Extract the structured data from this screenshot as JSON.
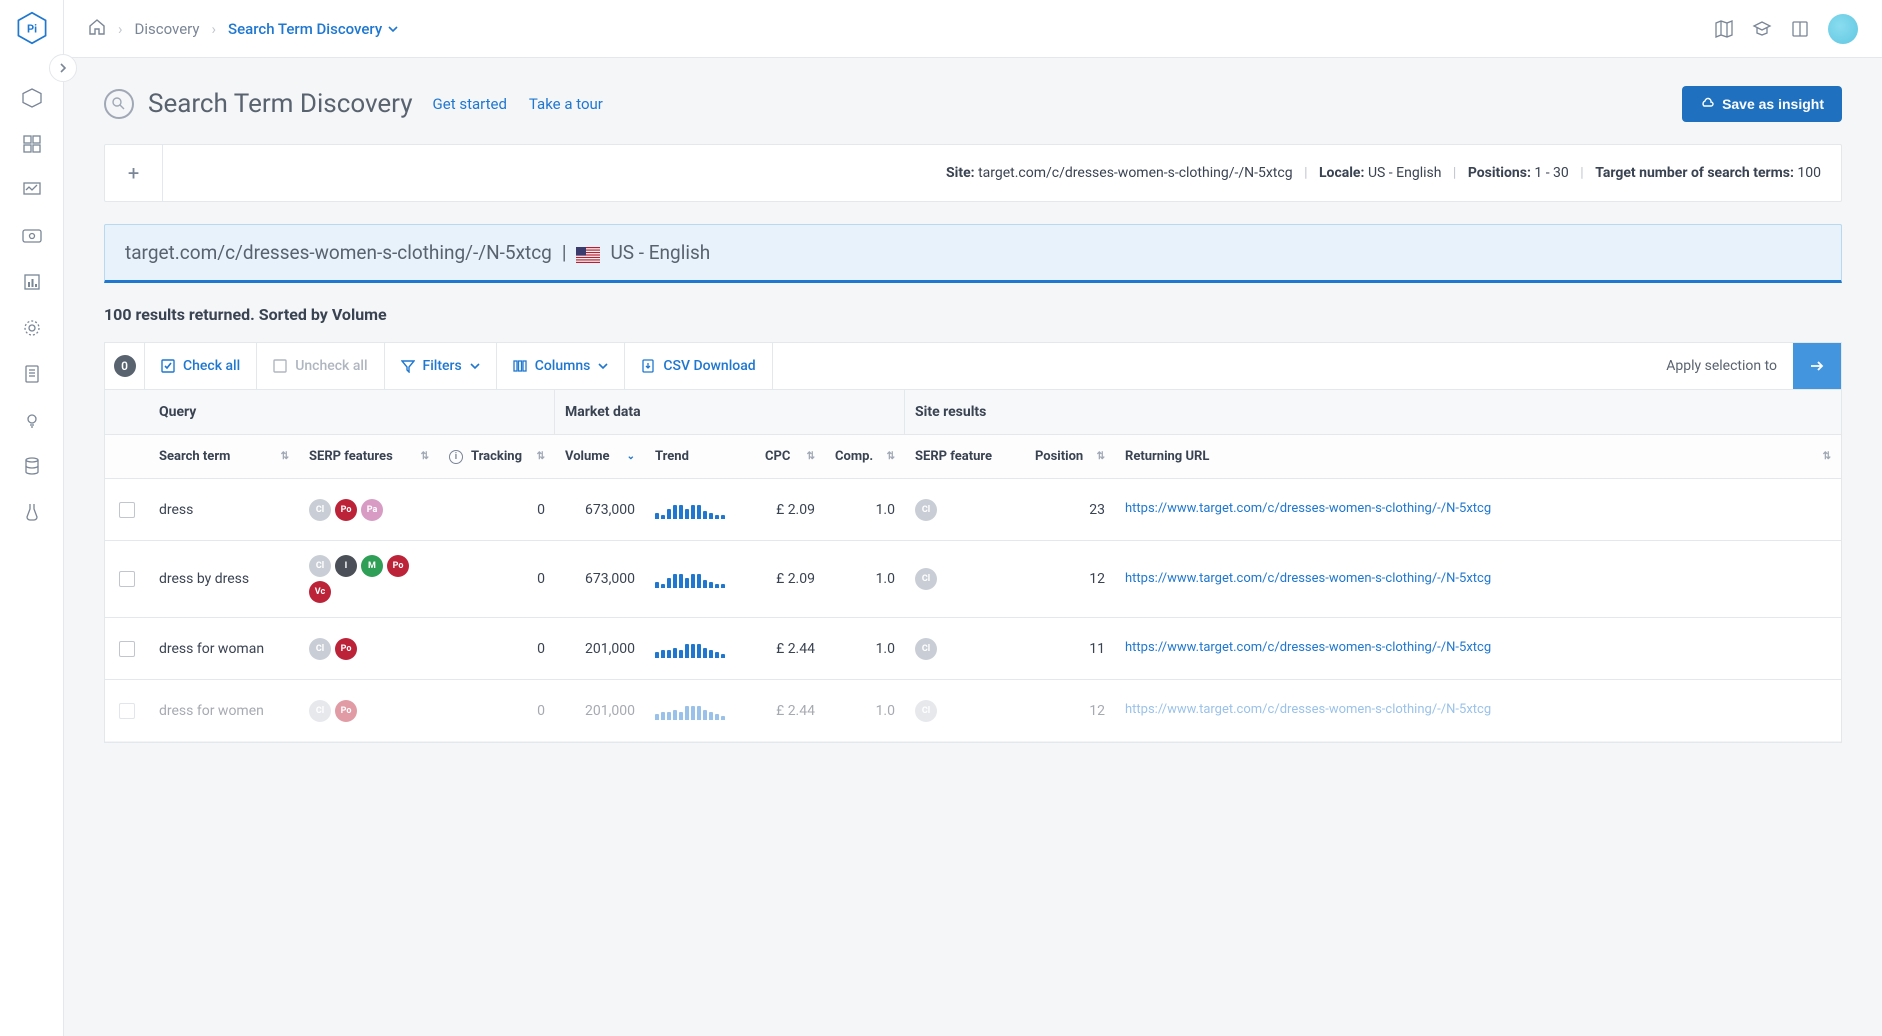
{
  "breadcrumb": {
    "link": "Discovery",
    "current": "Search Term Discovery"
  },
  "page": {
    "title": "Search Term Discovery",
    "get_started": "Get started",
    "take_tour": "Take a tour",
    "save_btn": "Save as insight"
  },
  "config": {
    "site_k": "Site:",
    "site_v": "target.com/c/dresses-women-s-clothing/-/N-5xtcg",
    "locale_k": "Locale:",
    "locale_v": "US - English",
    "positions_k": "Positions:",
    "positions_v": "1 - 30",
    "target_k": "Target number of search terms:",
    "target_v": "100"
  },
  "filter": {
    "site": "target.com/c/dresses-women-s-clothing/-/N-5xtcg",
    "sep": "|",
    "locale": "US - English"
  },
  "summary": "100 results returned. Sorted by Volume",
  "toolbar": {
    "count": "0",
    "check_all": "Check all",
    "uncheck_all": "Uncheck all",
    "filters": "Filters",
    "columns": "Columns",
    "csv": "CSV Download",
    "apply": "Apply selection to"
  },
  "columns": {
    "group_query": "Query",
    "group_market": "Market data",
    "group_site": "Site results",
    "search_term": "Search term",
    "serp_features": "SERP features",
    "tracking": "Tracking",
    "volume": "Volume",
    "trend": "Trend",
    "cpc": "CPC",
    "comp": "Comp.",
    "serp_feature": "SERP feature",
    "position": "Position",
    "url": "Returning URL"
  },
  "rows": [
    {
      "term": "dress",
      "features": [
        "Cl",
        "Po",
        "Pa"
      ],
      "tracking": "0",
      "volume": "673,000",
      "spark": [
        6,
        4,
        10,
        14,
        14,
        10,
        14,
        14,
        8,
        6,
        4,
        4
      ],
      "cpc": "£ 2.09",
      "comp": "1.0",
      "site_features": [
        "Cl"
      ],
      "position": "23",
      "url": "https://www.target.com/c/dresses-women-s-clothing/-/N-5xtcg",
      "faded": false
    },
    {
      "term": "dress by dress",
      "features": [
        "Cl",
        "I",
        "M",
        "Po",
        "Vc"
      ],
      "tracking": "0",
      "volume": "673,000",
      "spark": [
        6,
        4,
        10,
        14,
        14,
        10,
        14,
        14,
        8,
        6,
        4,
        4
      ],
      "cpc": "£ 2.09",
      "comp": "1.0",
      "site_features": [
        "Cl"
      ],
      "position": "12",
      "url": "https://www.target.com/c/dresses-women-s-clothing/-/N-5xtcg",
      "faded": false
    },
    {
      "term": "dress for woman",
      "features": [
        "Cl",
        "Po"
      ],
      "tracking": "0",
      "volume": "201,000",
      "spark": [
        6,
        8,
        8,
        10,
        8,
        14,
        14,
        14,
        10,
        8,
        6,
        4
      ],
      "cpc": "£ 2.44",
      "comp": "1.0",
      "site_features": [
        "Cl"
      ],
      "position": "11",
      "url": "https://www.target.com/c/dresses-women-s-clothing/-/N-5xtcg",
      "faded": false
    },
    {
      "term": "dress for women",
      "features": [
        "Cl",
        "Po"
      ],
      "tracking": "0",
      "volume": "201,000",
      "spark": [
        6,
        8,
        8,
        10,
        8,
        14,
        14,
        14,
        10,
        8,
        6,
        4
      ],
      "cpc": "£ 2.44",
      "comp": "1.0",
      "site_features": [
        "Cl"
      ],
      "position": "12",
      "url": "https://www.target.com/c/dresses-women-s-clothing/-/N-5xtcg",
      "faded": true
    }
  ]
}
